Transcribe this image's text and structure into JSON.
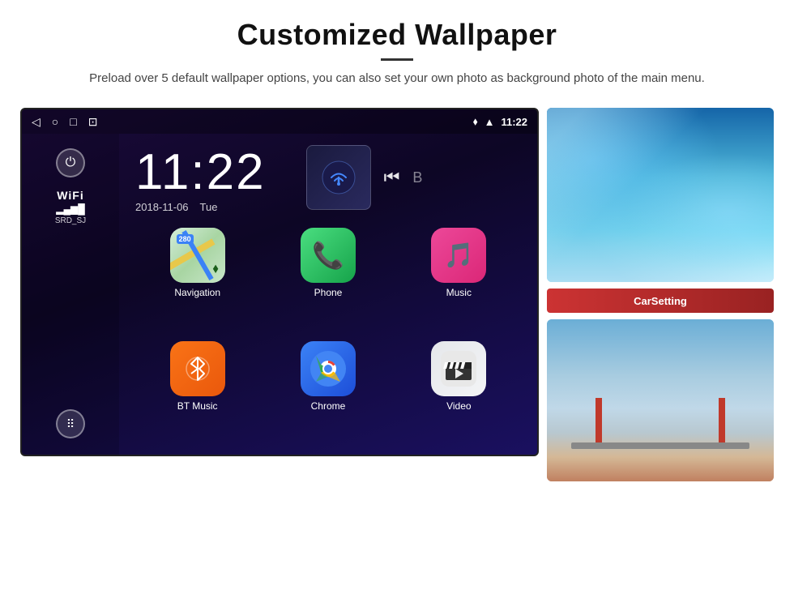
{
  "page": {
    "title": "Customized Wallpaper",
    "subtitle": "Preload over 5 default wallpaper options, you can also set your own photo as background photo of the main menu."
  },
  "android_screen": {
    "status_bar": {
      "time": "11:22",
      "nav_icons": [
        "◁",
        "○",
        "□",
        "⊡"
      ],
      "right_icons": [
        "location",
        "wifi",
        "signal"
      ]
    },
    "clock": {
      "time": "11:22",
      "date": "2018-11-06",
      "day": "Tue"
    },
    "sidebar": {
      "wifi_label": "WiFi",
      "wifi_network": "SRD_SJ"
    },
    "apps": [
      {
        "label": "Navigation",
        "icon": "nav"
      },
      {
        "label": "Phone",
        "icon": "phone"
      },
      {
        "label": "Music",
        "icon": "music"
      },
      {
        "label": "BT Music",
        "icon": "bt"
      },
      {
        "label": "Chrome",
        "icon": "chrome"
      },
      {
        "label": "Video",
        "icon": "video"
      }
    ],
    "carsetting_label": "CarSetting"
  }
}
